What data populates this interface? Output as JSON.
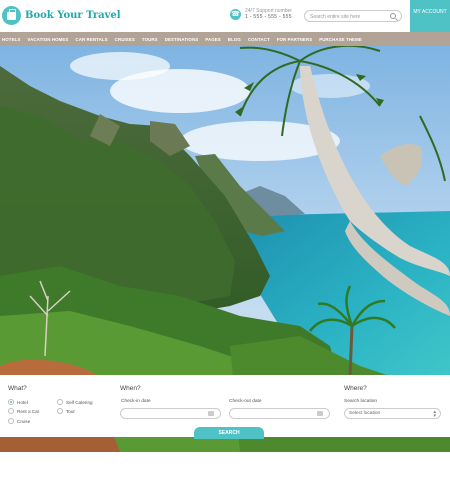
{
  "brand": {
    "name": "Book Your Travel",
    "logo_icon": "suitcase-icon"
  },
  "support": {
    "label": "24/7 Support number",
    "phone": "1 - 555 - 555 - 555",
    "icon": "phone-icon"
  },
  "search": {
    "placeholder": "Search entire site here"
  },
  "account": {
    "label": "MY ACCOUNT"
  },
  "nav": {
    "items": [
      "HOTELS",
      "VACATION HOMES",
      "CAR RENTALS",
      "CRUISES",
      "TOURS",
      "DESTINATIONS",
      "PAGES",
      "BLOG",
      "CONTACT",
      "FOR PARTNERS",
      "PURCHASE THEME"
    ]
  },
  "finder": {
    "what": {
      "title": "What?",
      "options": [
        {
          "label": "Hotel",
          "selected": true
        },
        {
          "label": "Rent a Car",
          "selected": false
        },
        {
          "label": "Cruise",
          "selected": false
        },
        {
          "label": "Self Catering",
          "selected": false
        },
        {
          "label": "Tour",
          "selected": false
        }
      ]
    },
    "when": {
      "title": "When?",
      "checkin_label": "Check-in date",
      "checkout_label": "Check-out date"
    },
    "where": {
      "title": "Where?",
      "location_label": "Search location",
      "location_value": "Select location"
    },
    "submit_label": "SEARCH"
  },
  "colors": {
    "accent": "#4fc2c6",
    "nav_bg": "#b1a396",
    "brand_text": "#1fa7ab"
  }
}
